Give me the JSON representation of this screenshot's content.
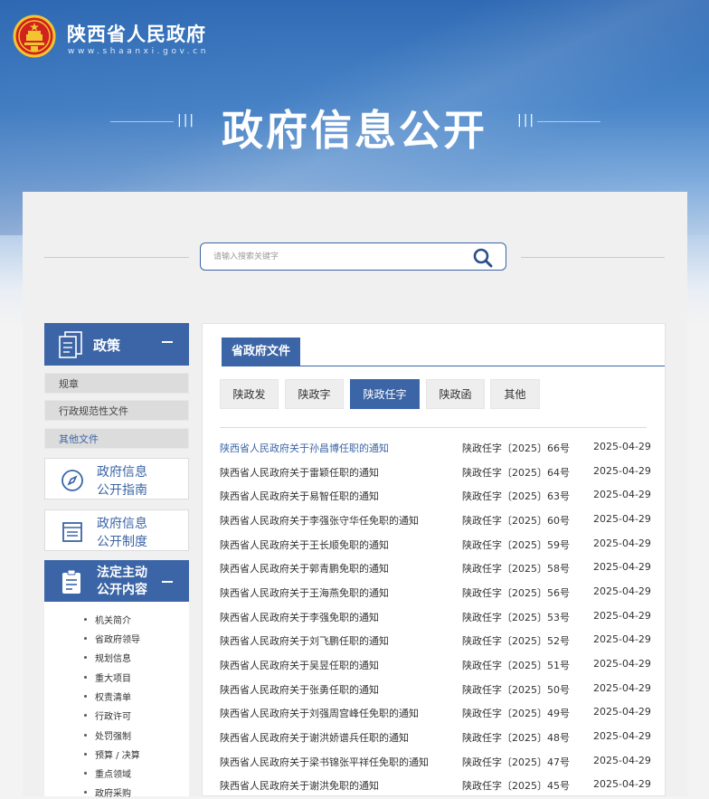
{
  "header": {
    "site_name": "陕西省人民政府",
    "site_url": "www.shaanxi.gov.cn",
    "banner_title": "政府信息公开"
  },
  "search": {
    "placeholder": "请输入搜索关键字"
  },
  "sidebar": {
    "policy": {
      "title": "政策",
      "items": [
        {
          "label": "规章"
        },
        {
          "label": "行政规范性文件"
        },
        {
          "label": "其他文件"
        }
      ]
    },
    "guide": {
      "line1": "政府信息",
      "line2": "公开指南"
    },
    "system": {
      "line1": "政府信息",
      "line2": "公开制度"
    },
    "statutory": {
      "line1": "法定主动",
      "line2": "公开内容",
      "items": [
        "机关简介",
        "省政府领导",
        "规划信息",
        "重大项目",
        "权责清单",
        "行政许可",
        "处罚强制",
        "预算 / 决算",
        "重点领域",
        "政府采购"
      ]
    }
  },
  "main": {
    "tab": "省政府文件",
    "filters": [
      "陕政发",
      "陕政字",
      "陕政任字",
      "陕政函",
      "其他"
    ],
    "active_filter": "陕政任字",
    "rows": [
      {
        "title": "陕西省人民政府关于孙昌博任职的通知",
        "number": "陕政任字〔2025〕66号",
        "date": "2025-04-29"
      },
      {
        "title": "陕西省人民政府关于雷颖任职的通知",
        "number": "陕政任字〔2025〕64号",
        "date": "2025-04-29"
      },
      {
        "title": "陕西省人民政府关于易智任职的通知",
        "number": "陕政任字〔2025〕63号",
        "date": "2025-04-29"
      },
      {
        "title": "陕西省人民政府关于李强张守华任免职的通知",
        "number": "陕政任字〔2025〕60号",
        "date": "2025-04-29"
      },
      {
        "title": "陕西省人民政府关于王长顺免职的通知",
        "number": "陕政任字〔2025〕59号",
        "date": "2025-04-29"
      },
      {
        "title": "陕西省人民政府关于郭青鹏免职的通知",
        "number": "陕政任字〔2025〕58号",
        "date": "2025-04-29"
      },
      {
        "title": "陕西省人民政府关于王海燕免职的通知",
        "number": "陕政任字〔2025〕56号",
        "date": "2025-04-29"
      },
      {
        "title": "陕西省人民政府关于李强免职的通知",
        "number": "陕政任字〔2025〕53号",
        "date": "2025-04-29"
      },
      {
        "title": "陕西省人民政府关于刘飞鹏任职的通知",
        "number": "陕政任字〔2025〕52号",
        "date": "2025-04-29"
      },
      {
        "title": "陕西省人民政府关于吴昱任职的通知",
        "number": "陕政任字〔2025〕51号",
        "date": "2025-04-29"
      },
      {
        "title": "陕西省人民政府关于张勇任职的通知",
        "number": "陕政任字〔2025〕50号",
        "date": "2025-04-29"
      },
      {
        "title": "陕西省人民政府关于刘强周宫峰任免职的通知",
        "number": "陕政任字〔2025〕49号",
        "date": "2025-04-29"
      },
      {
        "title": "陕西省人民政府关于谢洪娇谱兵任职的通知",
        "number": "陕政任字〔2025〕48号",
        "date": "2025-04-29"
      },
      {
        "title": "陕西省人民政府关于梁书锦张平祥任免职的通知",
        "number": "陕政任字〔2025〕47号",
        "date": "2025-04-29"
      },
      {
        "title": "陕西省人民政府关于谢洪免职的通知",
        "number": "陕政任字〔2025〕45号",
        "date": "2025-04-29"
      }
    ]
  },
  "colors": {
    "brand_blue": "#3b65a6",
    "header_blue": "#2f6ab4"
  }
}
